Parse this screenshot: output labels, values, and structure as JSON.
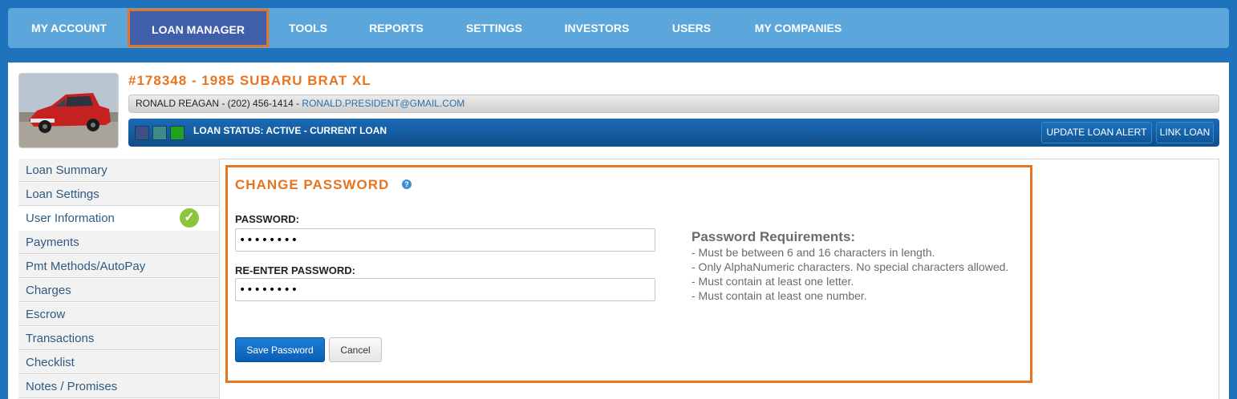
{
  "nav": {
    "items": [
      {
        "label": "MY ACCOUNT"
      },
      {
        "label": "LOAN MANAGER"
      },
      {
        "label": "TOOLS"
      },
      {
        "label": "REPORTS"
      },
      {
        "label": "SETTINGS"
      },
      {
        "label": "INVESTORS"
      },
      {
        "label": "USERS"
      },
      {
        "label": "MY COMPANIES"
      }
    ],
    "active_label": "LOAN MANAGER"
  },
  "loan": {
    "title": "#178348 - 1985 SUBARU BRAT XL",
    "contact_prefix": "RONALD REAGAN - (202) 456-1414 - ",
    "email": "RONALD.PRESIDENT@GMAIL.COM",
    "status": "LOAN STATUS: ACTIVE - CURRENT LOAN",
    "status_swatches": [
      "#3e4f86",
      "#3e8a84",
      "#1fa31f"
    ],
    "update_alert_label": "UPDATE LOAN ALERT",
    "link_loan_label": "LINK LOAN"
  },
  "sidebar": {
    "items": [
      {
        "label": "Loan Summary"
      },
      {
        "label": "Loan Settings"
      },
      {
        "label": "User Information"
      },
      {
        "label": "Payments"
      },
      {
        "label": "Pmt Methods/AutoPay"
      },
      {
        "label": "Charges"
      },
      {
        "label": "Escrow"
      },
      {
        "label": "Transactions"
      },
      {
        "label": "Checklist"
      },
      {
        "label": "Notes / Promises"
      }
    ],
    "active_label": "User Information",
    "active_icon": "checkmark-circle-icon"
  },
  "password_form": {
    "title": "CHANGE PASSWORD",
    "help_icon": "help-icon",
    "password_label": "PASSWORD:",
    "password_value": "••••••••",
    "reenter_label": "RE-ENTER PASSWORD:",
    "reenter_value": "••••••••",
    "save_label": "Save Password",
    "cancel_label": "Cancel",
    "requirements_title": "Password Requirements:",
    "requirements": [
      "- Must be between 6 and 16 characters in length.",
      "- Only AlphaNumeric characters. No special characters allowed.",
      "- Must contain at least one letter.",
      "- Must contain at least one number."
    ]
  },
  "colors": {
    "accent_orange": "#e8741f",
    "nav_blue": "#5ba7dc",
    "background_blue": "#1f73bd",
    "primary_button": "#0b5db3"
  }
}
